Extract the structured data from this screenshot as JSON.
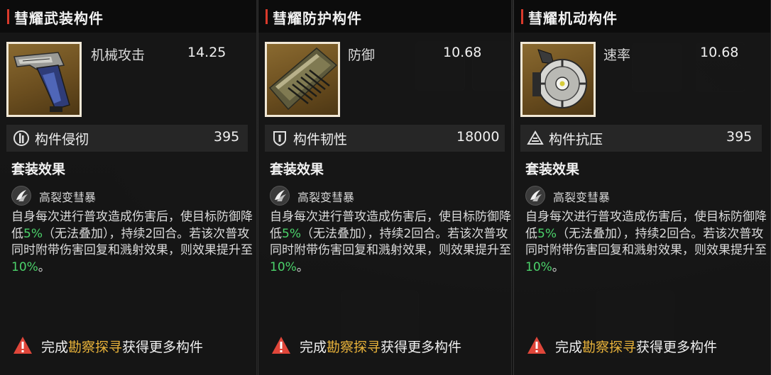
{
  "colors": {
    "accent_red": "#d93a2b",
    "highlight_green": "#4bd26a",
    "link_gold": "#e8b23a",
    "frame_cream": "#f1e8d6"
  },
  "cards": [
    {
      "title": "彗耀武装构件",
      "item_icon": "weapon-module-icon",
      "main_stat": {
        "name": "机械攻击",
        "value": "14.25"
      },
      "sub_stat": {
        "icon": "pierce-icon",
        "name": "构件侵彻",
        "value": "395"
      },
      "set_effect_title": "套装效果",
      "skill": {
        "icon": "skill-burst-icon",
        "name": "高裂变彗暴"
      },
      "desc": {
        "p1": "自身每次进行普攻造成伤害后，使目标防御降低",
        "hl1": "5%",
        "p2": "（无法叠加），持续2回合。若该次普攻同时附带伤害回复和溅射效果，则效果提升至",
        "hl2": "10%",
        "p3": "。"
      },
      "footer": {
        "pre": "完成",
        "link": "勘察探寻",
        "post": "获得更多构件"
      }
    },
    {
      "title": "彗耀防护构件",
      "item_icon": "armor-module-icon",
      "main_stat": {
        "name": "防御",
        "value": "10.68"
      },
      "sub_stat": {
        "icon": "shield-icon",
        "name": "构件韧性",
        "value": "18000"
      },
      "set_effect_title": "套装效果",
      "skill": {
        "icon": "skill-burst-icon",
        "name": "高裂变彗暴"
      },
      "desc": {
        "p1": "自身每次进行普攻造成伤害后，使目标防御降低",
        "hl1": "5%",
        "p2": "（无法叠加），持续2回合。若该次普攻同时附带伤害回复和溅射效果，则效果提升至",
        "hl2": "10%",
        "p3": "。"
      },
      "footer": {
        "pre": "完成",
        "link": "勘察探寻",
        "post": "获得更多构件"
      }
    },
    {
      "title": "彗耀机动构件",
      "item_icon": "mobility-module-icon",
      "main_stat": {
        "name": "速率",
        "value": "10.68"
      },
      "sub_stat": {
        "icon": "pressure-icon",
        "name": "构件抗压",
        "value": "395"
      },
      "set_effect_title": "套装效果",
      "skill": {
        "icon": "skill-burst-icon",
        "name": "高裂变彗暴"
      },
      "desc": {
        "p1": "自身每次进行普攻造成伤害后，使目标防御降低",
        "hl1": "5%",
        "p2": "（无法叠加），持续2回合。若该次普攻同时附带伤害回复和溅射效果，则效果提升至",
        "hl2": "10%",
        "p3": "。"
      },
      "footer": {
        "pre": "完成",
        "link": "勘察探寻",
        "post": "获得更多构件"
      }
    }
  ]
}
